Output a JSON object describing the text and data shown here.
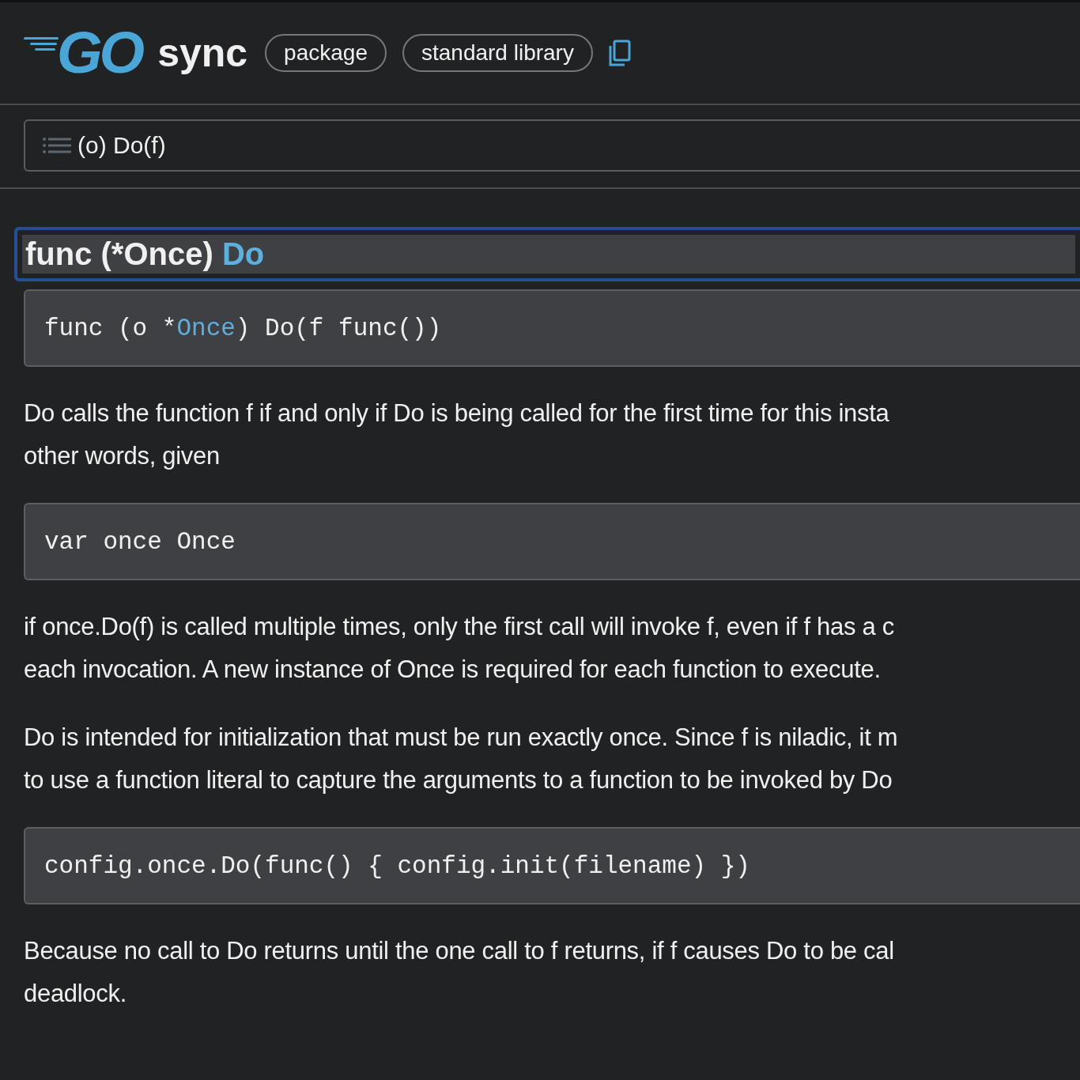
{
  "header": {
    "logo_text": "GO",
    "package_name": "sync",
    "badges": [
      "package",
      "standard library"
    ]
  },
  "outline_select": {
    "value": "(o) Do(f)"
  },
  "section": {
    "heading": [
      {
        "kind": "plain",
        "text": "func (*Once) "
      },
      {
        "kind": "link",
        "text": "Do"
      }
    ],
    "focused": true,
    "blocks": [
      {
        "kind": "code",
        "segments": [
          {
            "kind": "plain",
            "text": "func (o *"
          },
          {
            "kind": "link",
            "text": "Once"
          },
          {
            "kind": "plain",
            "text": ") Do(f func())"
          }
        ]
      },
      {
        "kind": "text",
        "lines": [
          "Do calls the function f if and only if Do is being called for the first time for this insta",
          "other words, given"
        ]
      },
      {
        "kind": "code",
        "segments": [
          {
            "kind": "plain",
            "text": "var once Once"
          }
        ]
      },
      {
        "kind": "text",
        "lines": [
          "if once.Do(f) is called multiple times, only the first call will invoke f, even if f has a c",
          "each invocation. A new instance of Once is required for each function to execute."
        ]
      },
      {
        "kind": "text",
        "lines": [
          "Do is intended for initialization that must be run exactly once. Since f is niladic, it m",
          "to use a function literal to capture the arguments to a function to be invoked by Do"
        ]
      },
      {
        "kind": "code",
        "segments": [
          {
            "kind": "plain",
            "text": "config.once.Do(func() { config.init(filename) })"
          }
        ]
      },
      {
        "kind": "text",
        "lines": [
          "Because no call to Do returns until the one call to f returns, if f causes Do to be cal",
          "deadlock."
        ]
      }
    ]
  }
}
